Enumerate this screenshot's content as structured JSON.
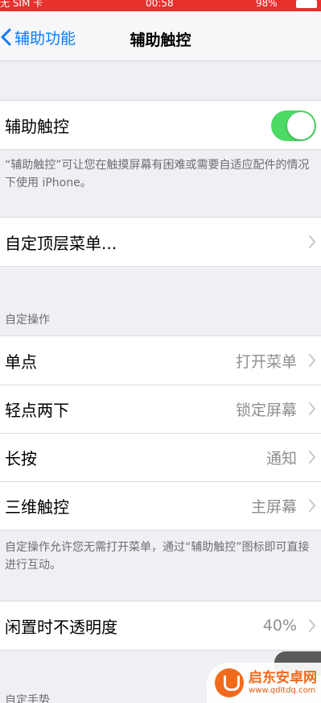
{
  "status_bar": {
    "carrier": "无 SIM 卡",
    "time": "00:58",
    "battery_percent": "98%"
  },
  "nav": {
    "back_label": "辅助功能",
    "title": "辅助触控"
  },
  "assistive_touch": {
    "label": "辅助触控",
    "enabled": true,
    "footnote": "“辅助触控”可让您在触摸屏幕有困难或需要自适应配件的情况下使用 iPhone。"
  },
  "customize_menu": {
    "label": "自定顶层菜单..."
  },
  "custom_actions": {
    "header": "自定操作",
    "items": [
      {
        "label": "单点",
        "value": "打开菜单"
      },
      {
        "label": "轻点两下",
        "value": "锁定屏幕"
      },
      {
        "label": "长按",
        "value": "通知"
      },
      {
        "label": "三维触控",
        "value": "主屏幕"
      }
    ],
    "footnote": "自定操作允许您无需打开菜单，通过“辅助触控”图标即可直接进行互动。"
  },
  "idle_opacity": {
    "label": "闲置时不透明度",
    "value": "40%"
  },
  "custom_gestures": {
    "header": "自定手势"
  },
  "watermark": {
    "name": "启东安卓网",
    "url": "www.qdltdq.com"
  },
  "colors": {
    "accent": "#0a7aff",
    "toggle_on": "#4cd964",
    "status_bar": "#e8302d"
  }
}
